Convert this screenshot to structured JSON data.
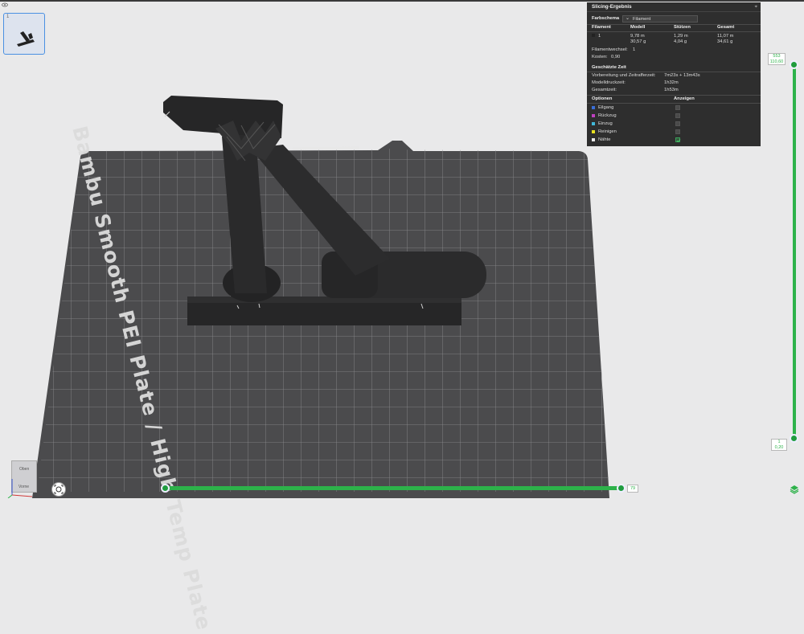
{
  "plate": {
    "number": "1",
    "bed_label": "Bambu Smooth PEI Plate / High Temp Plate"
  },
  "panel": {
    "title": "Slicing-Ergebnis",
    "color_scheme_label": "Farbschema",
    "color_scheme_value": "Filament",
    "table_headers": [
      "Filament",
      "Modell",
      "Stützen",
      "Gesamt"
    ],
    "filament_row": {
      "id": "1",
      "model_length": "9,78 m",
      "model_weight": "30,57 g",
      "support_length": "1,29 m",
      "support_weight": "4,04 g",
      "total_length": "11,07 m",
      "total_weight": "34,61 g"
    },
    "filament_changes_label": "Filamentwechsel:",
    "filament_changes_value": "1",
    "cost_label": "Kosten:",
    "cost_value": "0,90",
    "time_header": "Geschätzte Zeit",
    "time_rows": [
      {
        "label": "Vorbereitung und Zeitrafferzeit:",
        "value": "7m23s + 13m43s"
      },
      {
        "label": "Modelldruckzeit:",
        "value": "1h32m"
      },
      {
        "label": "Gesamtzeit:",
        "value": "1h53m"
      }
    ],
    "options_header": "Optionen",
    "show_header": "Anzeigen",
    "options": [
      {
        "label": "Eilgang",
        "color": "#3a6fd8",
        "checked": false
      },
      {
        "label": "Rückzug",
        "color": "#c040c0",
        "checked": false
      },
      {
        "label": "Einzug",
        "color": "#40b8d8",
        "checked": false
      },
      {
        "label": "Reinigen",
        "color": "#e8e020",
        "checked": false
      },
      {
        "label": "Nähte",
        "color": "#e8e8e8",
        "checked": true
      }
    ]
  },
  "layer_slider": {
    "top_layer": "553",
    "top_height": "110,60",
    "bottom_layer": "1",
    "bottom_height": "0,20"
  },
  "move_slider": {
    "value": "79"
  },
  "view_cube": {
    "top": "Oben",
    "front": "Vorne"
  },
  "colors": {
    "accent": "#2db24a",
    "panel_bg": "#2e2e2e",
    "bed": "#4d4d4f",
    "model": "#2a2a2b"
  }
}
